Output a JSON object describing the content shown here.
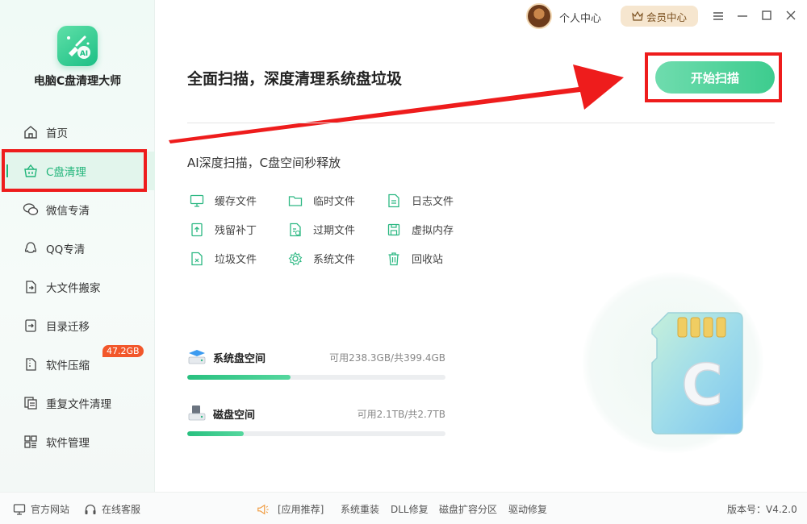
{
  "app": {
    "title": "电脑C盘清理大师",
    "logo_text": "AI"
  },
  "sidebar": {
    "items": [
      {
        "label": "首页",
        "icon": "home-icon"
      },
      {
        "label": "C盘清理",
        "icon": "basket-icon",
        "active": true
      },
      {
        "label": "微信专清",
        "icon": "wechat-icon"
      },
      {
        "label": "QQ专清",
        "icon": "qq-icon"
      },
      {
        "label": "大文件搬家",
        "icon": "move-file-icon"
      },
      {
        "label": "目录迁移",
        "icon": "folder-move-icon"
      },
      {
        "label": "软件压缩",
        "icon": "zip-icon",
        "badge": "47.2GB"
      },
      {
        "label": "重复文件清理",
        "icon": "duplicate-icon"
      },
      {
        "label": "软件管理",
        "icon": "apps-icon"
      }
    ]
  },
  "topbar": {
    "personal_center": "个人中心",
    "vip_center": "会员中心"
  },
  "main": {
    "title": "全面扫描，深度清理系统盘垃圾",
    "start_button": "开始扫描",
    "subtitle": "AI深度扫描，C盘空间秒释放",
    "categories": [
      {
        "label": "缓存文件",
        "icon": "monitor-icon"
      },
      {
        "label": "临时文件",
        "icon": "folder-icon"
      },
      {
        "label": "日志文件",
        "icon": "log-icon"
      },
      {
        "label": "残留补丁",
        "icon": "patch-icon"
      },
      {
        "label": "过期文件",
        "icon": "expired-file-icon"
      },
      {
        "label": "虚拟内存",
        "icon": "save-icon"
      },
      {
        "label": "垃圾文件",
        "icon": "junk-file-icon"
      },
      {
        "label": "系统文件",
        "icon": "gear-icon"
      },
      {
        "label": "回收站",
        "icon": "trash-icon"
      }
    ],
    "disks": [
      {
        "label": "系统盘空间",
        "info": "可用238.3GB/共399.4GB",
        "used_fraction": 0.4
      },
      {
        "label": "磁盘空间",
        "info": "可用2.1TB/共2.7TB",
        "used_fraction": 0.22
      }
    ],
    "illustration_letter": "C"
  },
  "footer": {
    "website": "官方网站",
    "support": "在线客服",
    "recommend": "[应用推荐]",
    "links": [
      "系统重装",
      "DLL修复",
      "磁盘扩容分区",
      "驱动修复"
    ],
    "version": "版本号：V4.2.0"
  },
  "colors": {
    "accent": "#21b57a",
    "highlight": "#ee1c1c",
    "badge": "#f2572b"
  }
}
